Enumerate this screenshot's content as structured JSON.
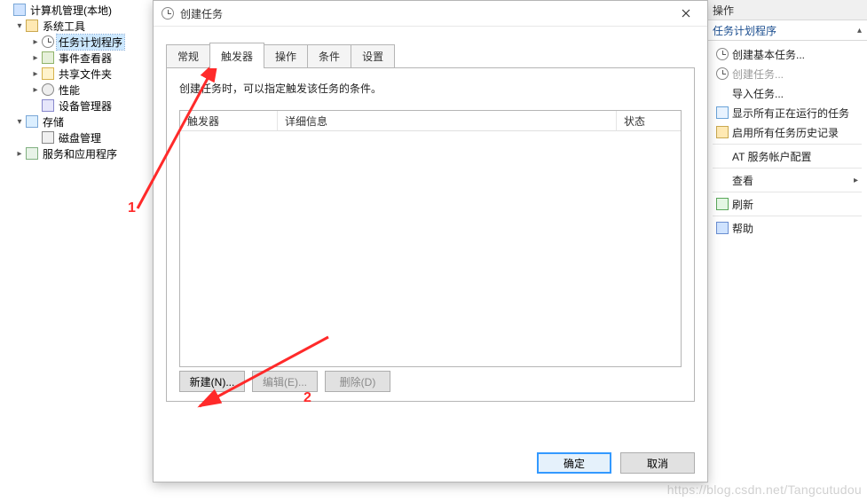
{
  "tree": {
    "root": {
      "label": "计算机管理(本地)"
    },
    "system": {
      "label": "系统工具"
    },
    "scheduler": {
      "label": "任务计划程序"
    },
    "event": {
      "label": "事件查看器"
    },
    "share": {
      "label": "共享文件夹"
    },
    "perf": {
      "label": "性能"
    },
    "devmgr": {
      "label": "设备管理器"
    },
    "storage": {
      "label": "存储"
    },
    "disk": {
      "label": "磁盘管理"
    },
    "services": {
      "label": "服务和应用程序"
    }
  },
  "actions": {
    "panel_title": "操作",
    "section": "任务计划程序",
    "create_basic": "创建基本任务...",
    "create_task": "创建任务...",
    "import": "导入任务...",
    "show_running": "显示所有正在运行的任务",
    "enable_hist": "启用所有任务历史记录",
    "at_config": "AT 服务帐户配置",
    "view": "查看",
    "refresh": "刷新",
    "help": "帮助"
  },
  "dialog": {
    "title": "创建任务",
    "tabs": {
      "general": "常规",
      "triggers": "触发器",
      "actions": "操作",
      "cond": "条件",
      "settings": "设置"
    },
    "desc": "创建任务时，可以指定触发该任务的条件。",
    "columns": {
      "trigger": "触发器",
      "detail": "详细信息",
      "status": "状态"
    },
    "buttons": {
      "new": "新建(N)...",
      "edit": "编辑(E)...",
      "delete": "删除(D)"
    },
    "ok": "确定",
    "cancel": "取消"
  },
  "annotations": {
    "n1": "1",
    "n2": "2"
  },
  "watermark": "https://blog.csdn.net/Tangcutudou"
}
